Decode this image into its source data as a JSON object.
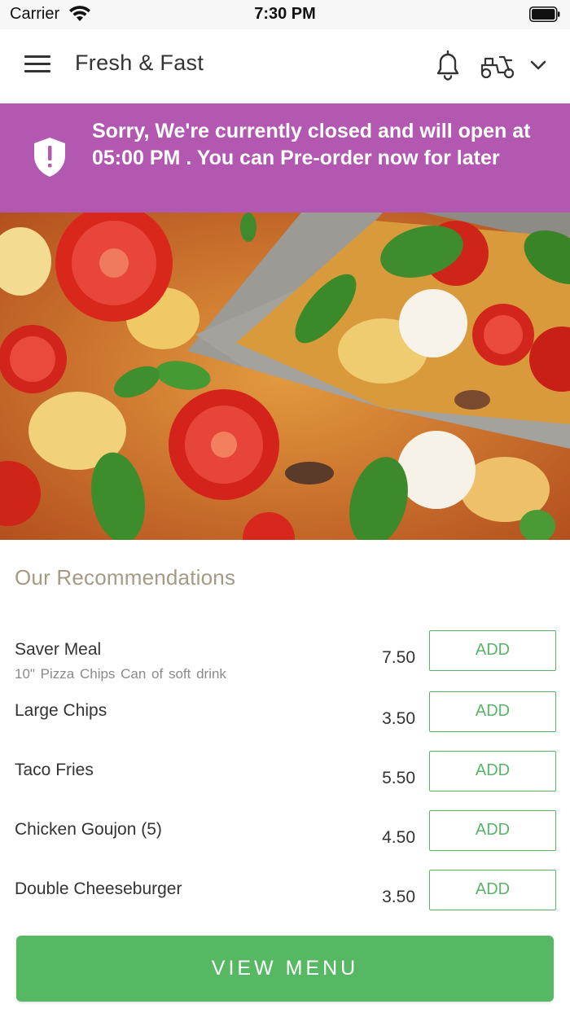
{
  "status_bar": {
    "carrier": "Carrier",
    "time": "7:30 PM"
  },
  "header": {
    "title": "Fresh & Fast",
    "icons": [
      "menu-icon",
      "bell-icon",
      "scooter-icon",
      "chevron-down-icon"
    ]
  },
  "banner": {
    "message": "Sorry, We're currently closed and will open at 05:00 PM . You can Pre-order now for later",
    "icon": "shield-alert-icon",
    "background": "#b358b0"
  },
  "recommendations": {
    "title": "Our Recommendations",
    "items": [
      {
        "name": "Saver Meal",
        "description": "10\" Pizza  Chips  Can of soft drink",
        "price": "7.50",
        "button": "ADD"
      },
      {
        "name": "Large Chips",
        "description": "",
        "price": "3.50",
        "button": "ADD"
      },
      {
        "name": "Taco Fries",
        "description": "",
        "price": "5.50",
        "button": "ADD"
      },
      {
        "name": "Chicken Goujon (5)",
        "description": "",
        "price": "4.50",
        "button": "ADD"
      },
      {
        "name": "Double Cheeseburger",
        "description": "",
        "price": "3.50",
        "button": "ADD"
      }
    ]
  },
  "footer": {
    "view_menu_label": "VIEW MENU"
  },
  "colors": {
    "accent_green": "#56b862",
    "banner_purple": "#b358b0",
    "section_title": "#a59a83"
  }
}
